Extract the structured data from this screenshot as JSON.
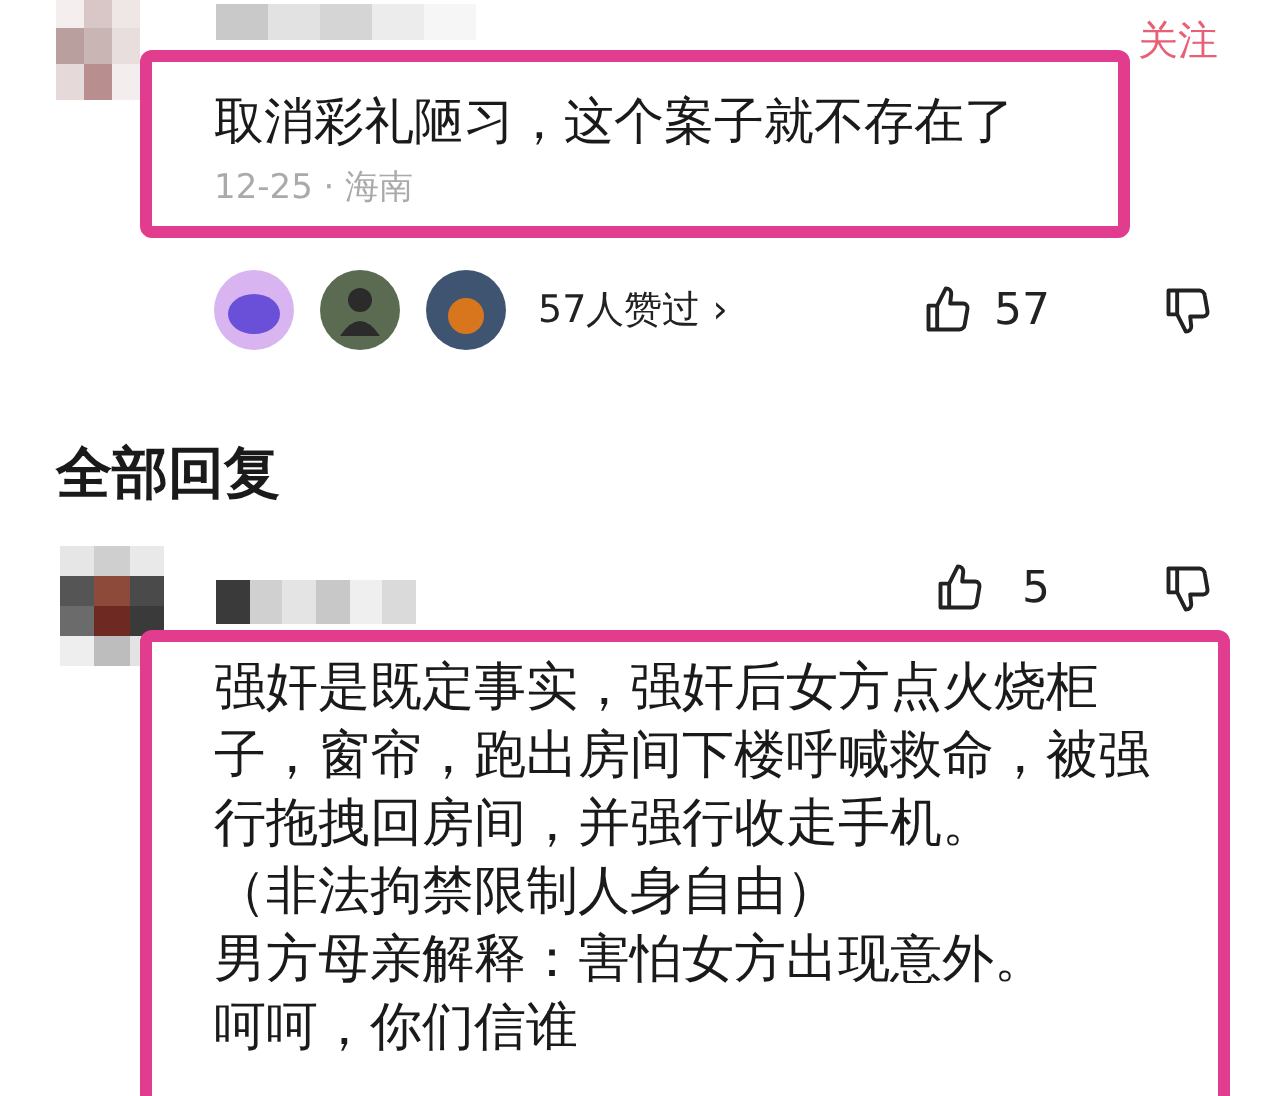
{
  "comment": {
    "follow_label": "关注",
    "text": "取消彩礼陋习，这个案子就不存在了",
    "meta": "12-25 · 海南",
    "likers_label": "57人赞过 ›",
    "like_count": "57"
  },
  "replies_heading": "全部回复",
  "reply": {
    "like_count": "5",
    "paragraphs": [
      "强奸是既定事实，强奸后女方点火烧柜子，窗帘，跑出房间下楼呼喊救命，被强行拖拽回房间，并强行收走手机。",
      "（非法拘禁限制人身自由）",
      "男方母亲解释：害怕女方出现意外。",
      "呵呵，你们信谁"
    ]
  }
}
